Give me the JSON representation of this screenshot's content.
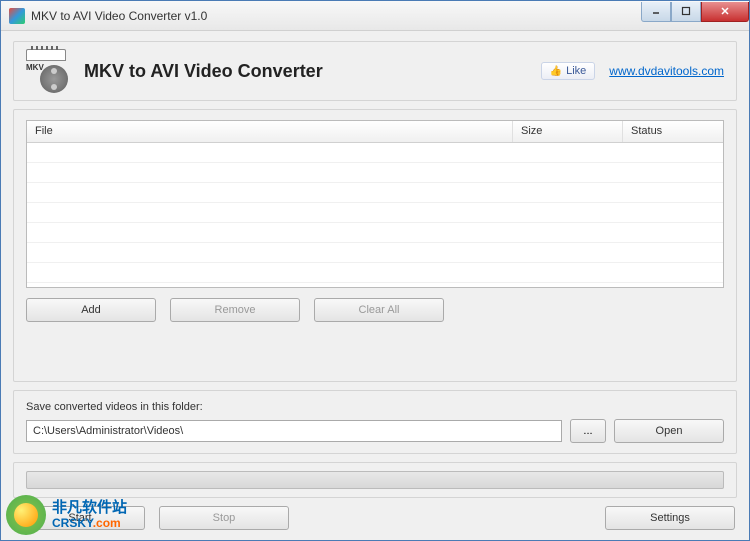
{
  "window": {
    "title": "MKV to AVI Video Converter v1.0"
  },
  "header": {
    "icon_label": "MKV",
    "title": "MKV to AVI Video Converter",
    "like_label": "Like",
    "site_link": "www.dvdavitools.com"
  },
  "table": {
    "columns": {
      "file": "File",
      "size": "Size",
      "status": "Status"
    },
    "rows": []
  },
  "buttons": {
    "add": "Add",
    "remove": "Remove",
    "clear_all": "Clear All",
    "browse": "...",
    "open": "Open",
    "start": "Start",
    "stop": "Stop",
    "settings": "Settings"
  },
  "save": {
    "label": "Save converted videos in this folder:",
    "path": "C:\\Users\\Administrator\\Videos\\"
  },
  "watermark": {
    "cn": "非凡软件站",
    "en_pre": "CRSKY",
    "en_suf": ".com"
  }
}
